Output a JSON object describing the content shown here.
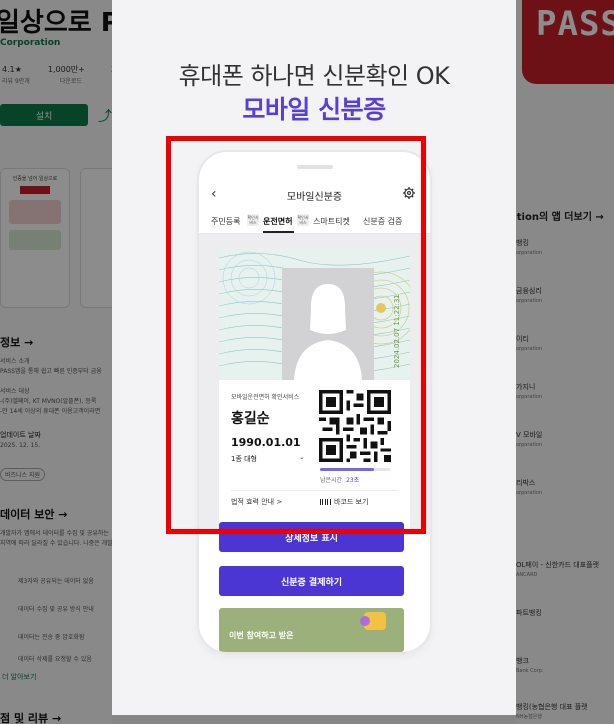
{
  "background_store": {
    "app_title_fragment": "일상으로 P",
    "company": "Corporation",
    "stats": [
      "4.1★",
      "1,000만+",
      "3"
    ],
    "stats_sub": [
      "리뷰 9만개",
      "다운로드",
      ""
    ],
    "install_label": "설치",
    "screenshot_caption": "인증을 넘어 일상으로",
    "screenshot_logo": "PASS",
    "section_info": "정보 →",
    "info_lines": [
      "서비스 소개",
      "PASS앱을 통해 쉽고 빠른 인증부터 금융",
      "",
      "서비스 대상",
      "-(주)엘페이, KT MVNO(알뜰폰), 등록",
      "-만 14세 이상의 휴대폰 이용고객이라면"
    ],
    "update_label": "업데이트 날짜",
    "update_date": "2025. 12. 15.",
    "category_chip": "비즈니스 지원",
    "section_security": "데이터 보안 →",
    "security_lines": [
      "개발자가 앱에서 데이터를 수집 및 공유하는",
      "지역에 따라 달라질 수 있습니다. 나중은 개발자"
    ],
    "security_items": [
      "제3자와 공유되는 데이터 없음",
      "데이터 수집 및 공유 방식 안내",
      "데이터는 전송 중 암호화됨",
      "데이터 삭제를 요청할 수 있음"
    ],
    "details_link": "더 알아보기",
    "section_reviews": "점 및 리뷰 →",
    "right_logo": "PASS",
    "right_more": "ation의 앱 더보기 →",
    "right_items": [
      {
        "name": "뱅킹",
        "sub": "orporation"
      },
      {
        "name": "금융심리",
        "sub": "orporation"
      },
      {
        "name": "이티",
        "sub": "orporation"
      },
      {
        "name": "가지니",
        "sub": "orporation"
      },
      {
        "name": "V 모바일",
        "sub": "orporation"
      },
      {
        "name": "리박스",
        "sub": "orporation"
      },
      {
        "name": "OL페이 - 신한카드 대표플랫",
        "sub": "ANCARD"
      },
      {
        "name": "파트뱅킹",
        "sub": ""
      },
      {
        "name": "뱅크",
        "sub": "Bank Corp."
      },
      {
        "name": "뱅킹(농협은행 대표 플랫",
        "sub": "NH농협은행"
      }
    ]
  },
  "modal": {
    "headline": "휴대폰 하나면 신분확인 OK",
    "headline_accent": "모바일 신분증",
    "accent_color": "#5a3fd6",
    "highlight_color": "#ee0000"
  },
  "phone": {
    "screen_title": "모바일신분증",
    "back_icon": "chevron-left",
    "settings_icon": "gear",
    "tabs": [
      {
        "label": "주민등록",
        "tag": "확인서비스"
      },
      {
        "label": "운전면허",
        "tag": "확인서비스",
        "active": true
      },
      {
        "label": "스마트티켓",
        "tag": ""
      },
      {
        "label": "신분증 검증",
        "tag": ""
      }
    ],
    "card": {
      "issue_date": "2024.02.07 11:22:31",
      "verify_label": "모바일운전면허 확인서비스",
      "name": "홍길순",
      "birth": "1990.01.01",
      "license_type": "1종 대형",
      "timer_label": "남은시간",
      "timer_value": "23초",
      "timer_fraction": 0.77,
      "law_link": "법적 효력 안내 >",
      "barcode_label": "바코드 보기"
    },
    "buttons": {
      "detail": "상세정보 표시",
      "pay": "신분증 결제하기"
    },
    "banner_text": "이번 참여하고 받은"
  }
}
